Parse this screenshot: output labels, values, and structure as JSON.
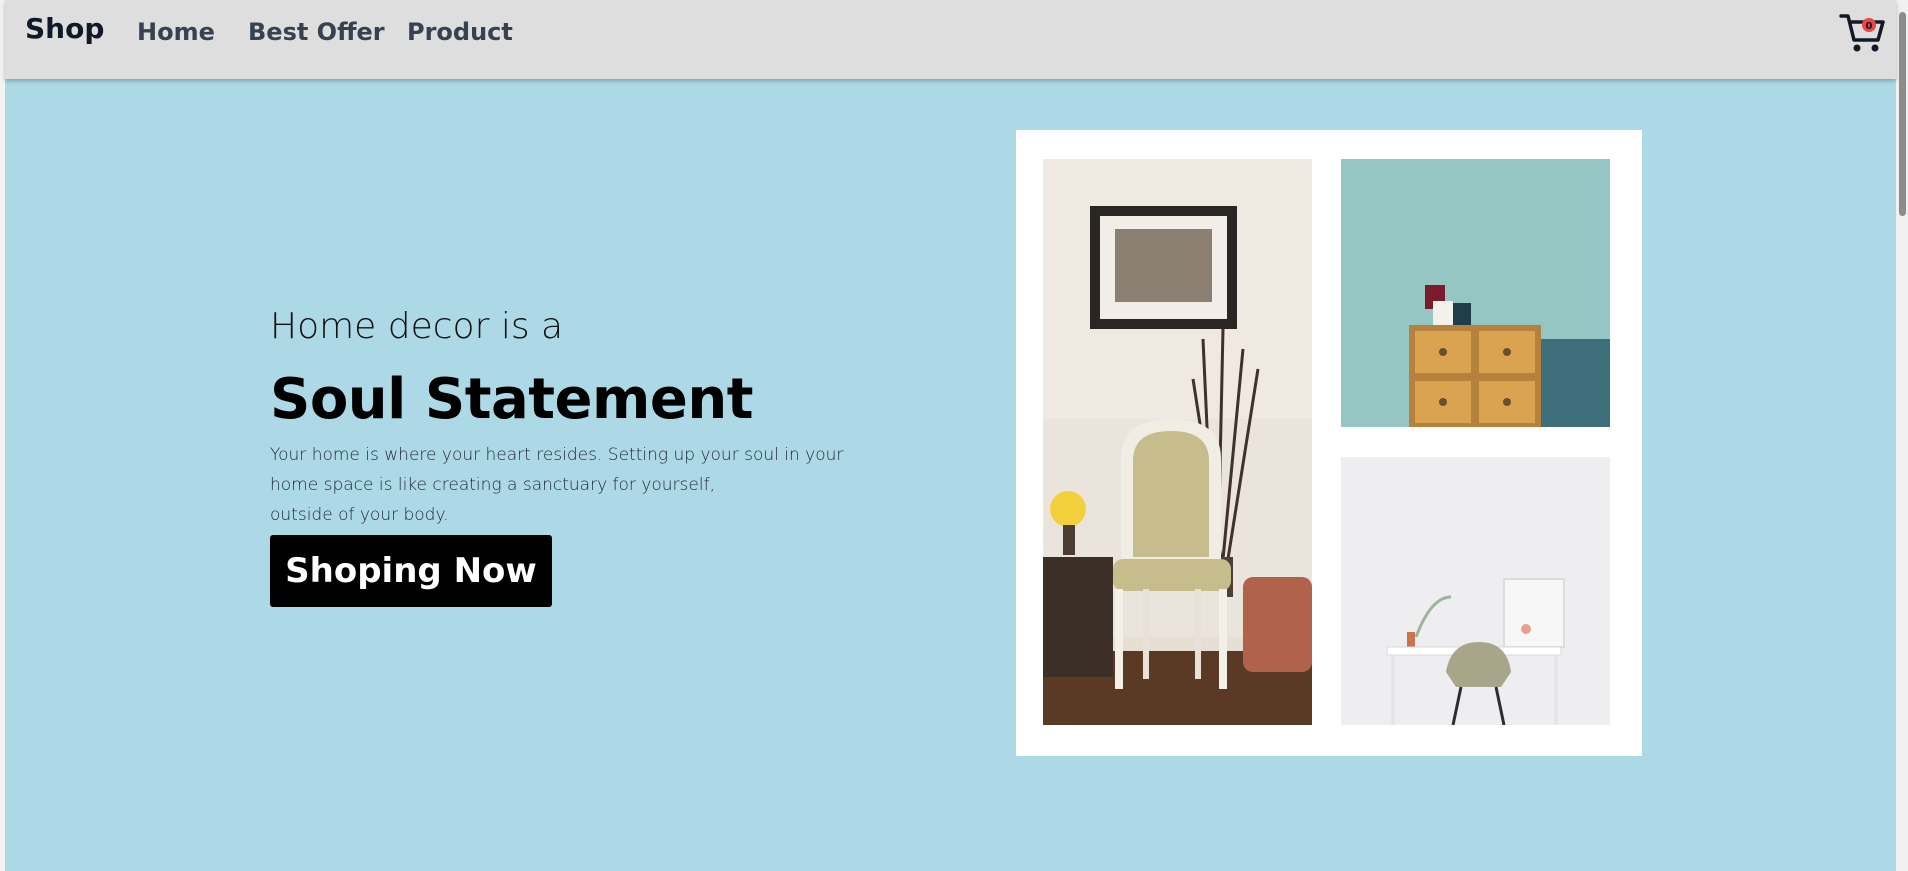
{
  "nav": {
    "brand": "Shop",
    "links": [
      "Home",
      "Best Offer",
      "Product"
    ],
    "cart_icon": "shopping-cart-icon",
    "cart_count": "0"
  },
  "hero": {
    "subtitle": "Home decor is a",
    "title": "Soul Statement",
    "description_lines": [
      "Your home is where your heart resides. Setting up your soul in your",
      "home space is like creating a sanctuary for yourself,",
      "outside of your body."
    ],
    "cta_label": "Shoping Now",
    "background_color": "#add8e6"
  },
  "gallery": {
    "images": [
      "chair-with-frame-photo",
      "drawer-cabinet-with-mugs-photo",
      "desk-and-chair-photo"
    ]
  },
  "colors": {
    "navbar": "#dedede",
    "cta": "#000000",
    "badge": "#ef4444"
  }
}
